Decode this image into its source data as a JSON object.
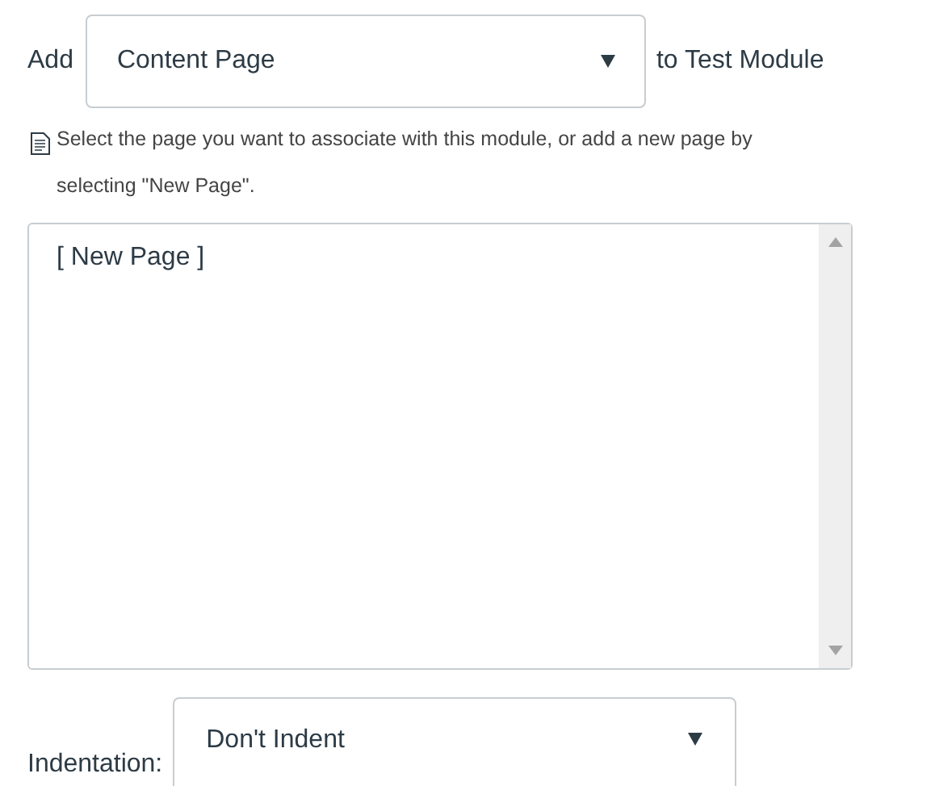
{
  "add_row": {
    "prefix": "Add",
    "type_select": {
      "value": "Content Page"
    },
    "suffix": "to Test Module"
  },
  "hint": "Select the page you want to associate with this module, or add a new page by selecting \"New Page\".",
  "page_list": {
    "items": [
      {
        "label": "[ New Page ]"
      }
    ]
  },
  "indentation": {
    "label": "Indentation:",
    "select": {
      "value": "Don't Indent"
    }
  }
}
